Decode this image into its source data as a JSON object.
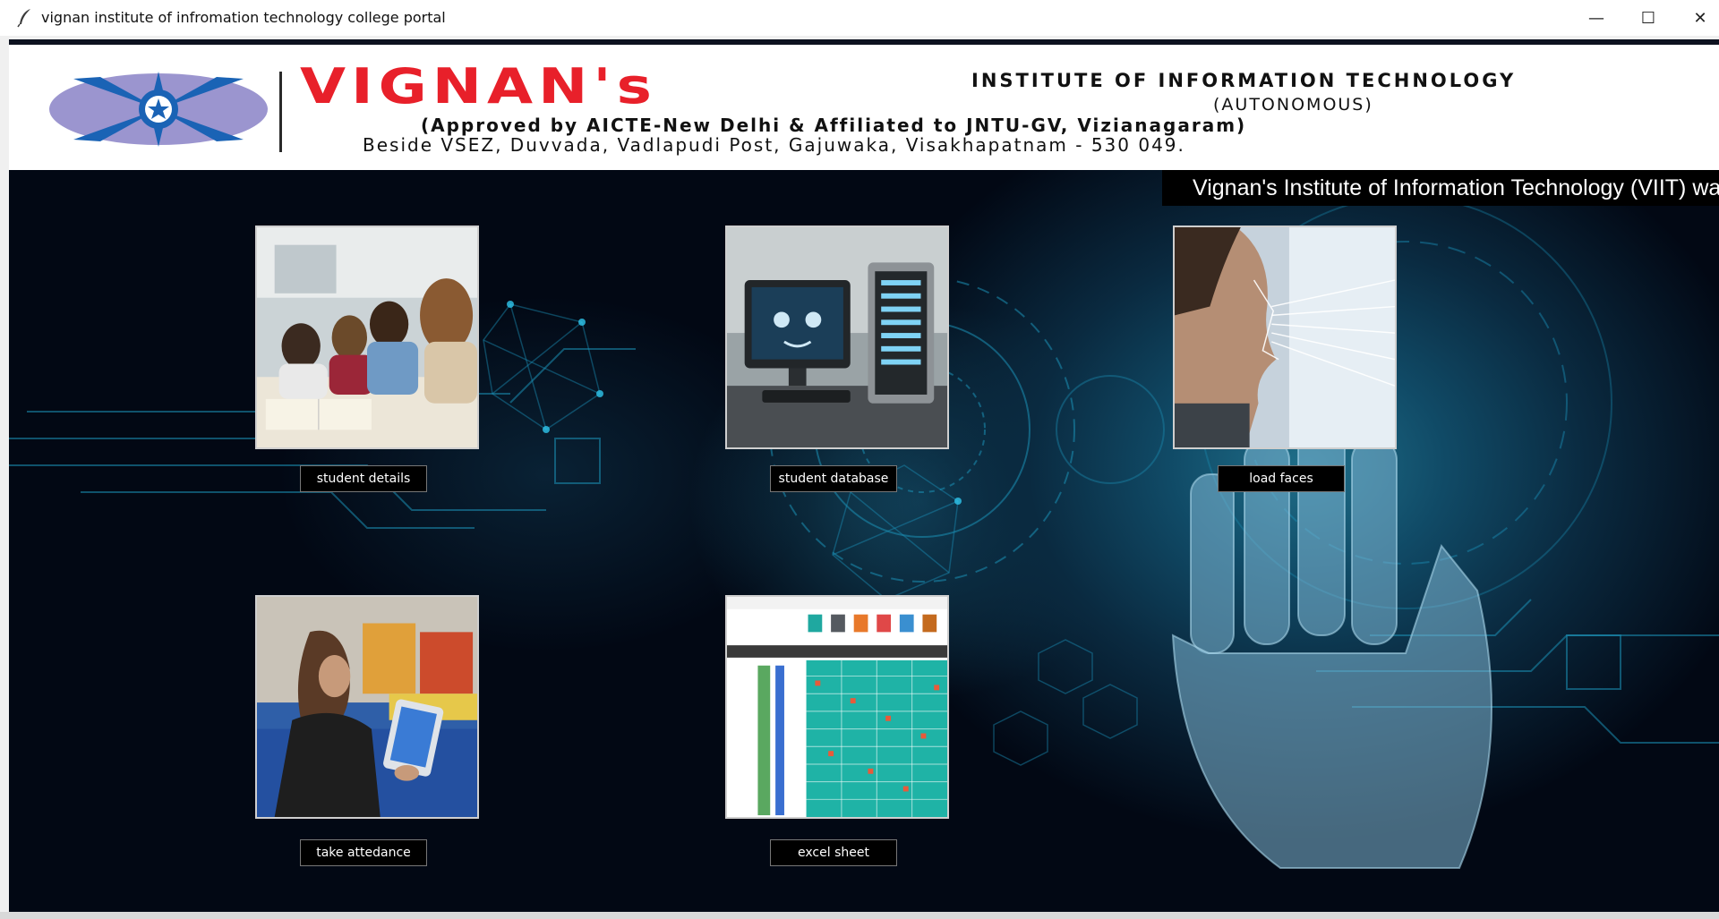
{
  "window": {
    "title": "vignan institute of infromation technology college portal",
    "controls": {
      "minimize": "—",
      "maximize": "☐",
      "close": "✕"
    }
  },
  "banner": {
    "brand": "VIGNAN's",
    "institute": "INSTITUTE OF INFORMATION TECHNOLOGY",
    "autonomous": "(AUTONOMOUS)",
    "approval": "(Approved by AICTE-New Delhi & Affiliated to JNTU-GV, Vizianagaram)",
    "address": "Beside VSEZ, Duvvada, Vadlapudi Post, Gajuwaka, Visakhapatnam - 530 049.",
    "brand_color": "#e8202a"
  },
  "marquee": {
    "text": "Vignan's Institute of Information Technology (VIIT) wa"
  },
  "buttons": {
    "student_details": "student details",
    "student_database": "student database",
    "load_faces": "load faces",
    "take_attendance": "take attedance",
    "excel_sheet": "excel sheet"
  },
  "tile_images": {
    "student_details": "students-studying-photo",
    "student_database": "computer-server-photo",
    "load_faces": "face-scan-photo",
    "take_attendance": "tablet-attendance-photo",
    "excel_sheet": "spreadsheet-screenshot"
  },
  "colors": {
    "background": "#020814",
    "button_bg": "#000000",
    "button_text": "#ffffff",
    "accent": "#1fa8d0"
  }
}
